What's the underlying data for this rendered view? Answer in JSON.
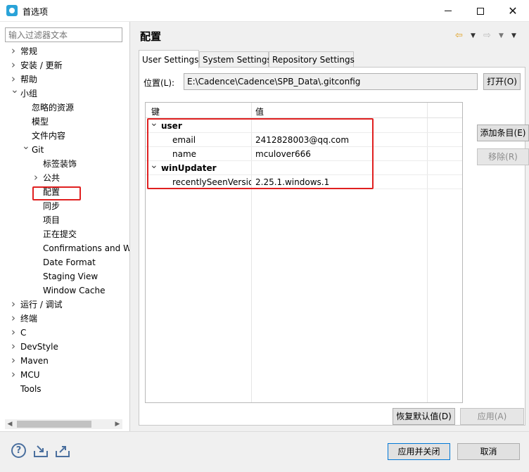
{
  "window": {
    "title": "首选项"
  },
  "filter": {
    "placeholder": "输入过滤器文本"
  },
  "tree": [
    {
      "label": "常规",
      "indent": 0,
      "chevron": "right"
    },
    {
      "label": "安装 / 更新",
      "indent": 0,
      "chevron": "right"
    },
    {
      "label": "帮助",
      "indent": 0,
      "chevron": "right"
    },
    {
      "label": "小组",
      "indent": 0,
      "chevron": "down"
    },
    {
      "label": "忽略的资源",
      "indent": 1,
      "chevron": "none"
    },
    {
      "label": "模型",
      "indent": 1,
      "chevron": "none"
    },
    {
      "label": "文件内容",
      "indent": 1,
      "chevron": "none"
    },
    {
      "label": "Git",
      "indent": 1,
      "chevron": "down"
    },
    {
      "label": "标签装饰",
      "indent": 2,
      "chevron": "none"
    },
    {
      "label": "公共",
      "indent": 2,
      "chevron": "right"
    },
    {
      "label": "配置",
      "indent": 2,
      "chevron": "none",
      "selected": true
    },
    {
      "label": "同步",
      "indent": 2,
      "chevron": "none"
    },
    {
      "label": "项目",
      "indent": 2,
      "chevron": "none"
    },
    {
      "label": "正在提交",
      "indent": 2,
      "chevron": "none"
    },
    {
      "label": "Confirmations and W",
      "indent": 2,
      "chevron": "none"
    },
    {
      "label": "Date Format",
      "indent": 2,
      "chevron": "none"
    },
    {
      "label": "Staging View",
      "indent": 2,
      "chevron": "none"
    },
    {
      "label": "Window Cache",
      "indent": 2,
      "chevron": "none"
    },
    {
      "label": "运行 / 调试",
      "indent": 0,
      "chevron": "right"
    },
    {
      "label": "终端",
      "indent": 0,
      "chevron": "right"
    },
    {
      "label": "C",
      "indent": 0,
      "chevron": "right"
    },
    {
      "label": "DevStyle",
      "indent": 0,
      "chevron": "right"
    },
    {
      "label": "Maven",
      "indent": 0,
      "chevron": "right"
    },
    {
      "label": "MCU",
      "indent": 0,
      "chevron": "right"
    },
    {
      "label": "Tools",
      "indent": 0,
      "chevron": "none"
    }
  ],
  "page": {
    "title": "配置"
  },
  "tabs": [
    {
      "label": "User Settings",
      "active": true
    },
    {
      "label": "System Settings",
      "active": false
    },
    {
      "label": "Repository Settings",
      "active": false
    }
  ],
  "location": {
    "label": "位置(L):",
    "value": "E:\\Cadence\\Cadence\\SPB_Data\\.gitconfig",
    "open_label": "打开(O)"
  },
  "grid": {
    "columns": [
      "键",
      "值"
    ],
    "rows": [
      {
        "key": "user",
        "value": "",
        "section": true
      },
      {
        "key": "email",
        "value": "2412828003@qq.com",
        "section": false
      },
      {
        "key": "name",
        "value": "mculover666",
        "section": false
      },
      {
        "key": "winUpdater",
        "value": "",
        "section": true
      },
      {
        "key": "recentlySeenVersion",
        "value": "2.25.1.windows.1",
        "section": false
      }
    ]
  },
  "buttons": {
    "add": "添加条目(E)",
    "remove": "移除(R)",
    "restore": "恢复默认值(D)",
    "apply": "应用(A)",
    "apply_close": "应用并关闭",
    "cancel": "取消"
  },
  "colors": {
    "highlight": "#e02020",
    "accent": "#0078d7"
  }
}
